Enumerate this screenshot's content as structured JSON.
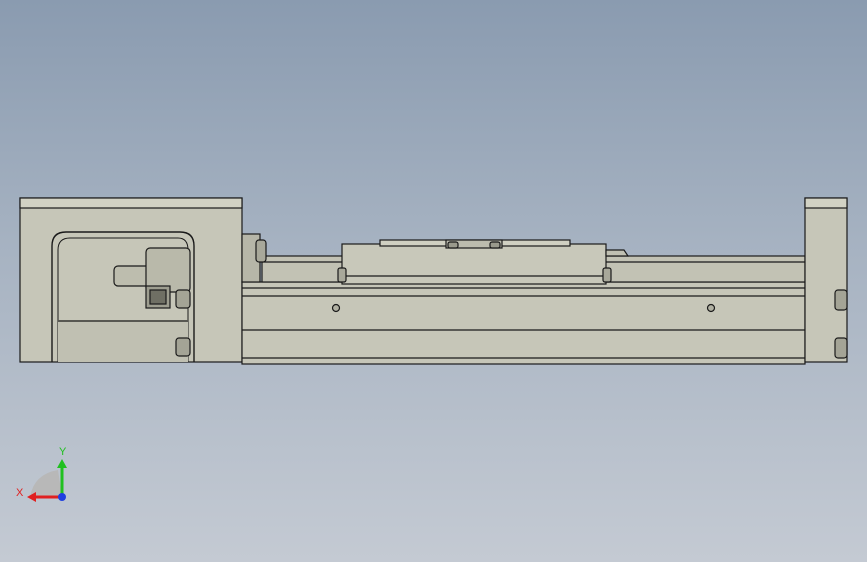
{
  "view": {
    "background_top": "#8a9bb0",
    "background_bottom": "#c4cad3",
    "part_fill": "#c6c6b8",
    "part_shade": "#a9a99a",
    "edge_color": "#1a1a1a"
  },
  "triad": {
    "x_label": "X",
    "y_label": "Y",
    "x_color": "#e02020",
    "y_color": "#20c020",
    "z_color": "#2040e0"
  }
}
